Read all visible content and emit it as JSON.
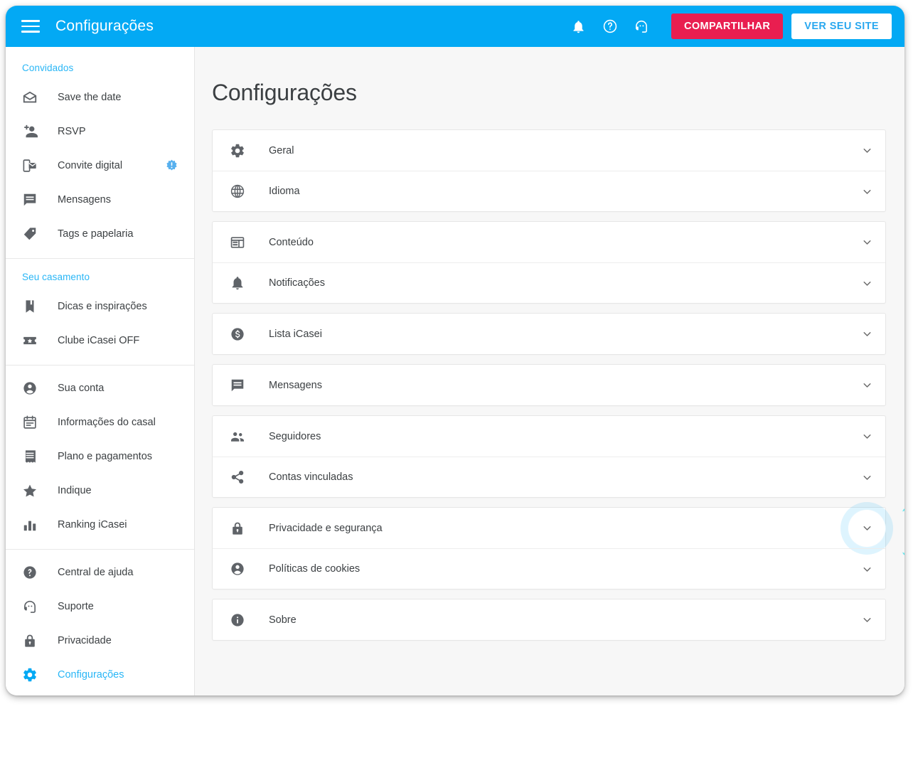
{
  "topbar": {
    "title": "Configurações",
    "menu_icon": "hamburger-menu-icon",
    "icons": [
      {
        "name": "notifications-bell-icon"
      },
      {
        "name": "help-circle-icon"
      },
      {
        "name": "support-headset-icon"
      }
    ],
    "share_label": "COMPARTILHAR",
    "site_label": "VER SEU SITE",
    "accent_color": "#03A9F4",
    "share_color": "#E91E50",
    "site_text_color": "#2aa8ef"
  },
  "sidebar": {
    "sections": [
      {
        "heading": "Convidados",
        "items": [
          {
            "label": "Save the date",
            "icon": "mail-open-icon",
            "badge": null,
            "active": false
          },
          {
            "label": "RSVP",
            "icon": "person-add-icon",
            "badge": null,
            "active": false
          },
          {
            "label": "Convite digital",
            "icon": "mobile-invite-icon",
            "badge": "!",
            "active": false
          },
          {
            "label": "Mensagens",
            "icon": "chat-bubble-icon",
            "badge": null,
            "active": false
          },
          {
            "label": "Tags e papelaria",
            "icon": "tag-icon",
            "badge": null,
            "active": false
          }
        ]
      },
      {
        "heading": "Seu casamento",
        "items": [
          {
            "label": "Dicas e inspirações",
            "icon": "bookmark-book-icon",
            "badge": null,
            "active": false
          },
          {
            "label": "Clube iCasei OFF",
            "icon": "ticket-star-icon",
            "badge": null,
            "active": false
          }
        ]
      },
      {
        "heading": null,
        "items": [
          {
            "label": "Sua conta",
            "icon": "account-circle-icon",
            "badge": null,
            "active": false
          },
          {
            "label": "Informações do casal",
            "icon": "calendar-note-icon",
            "badge": null,
            "active": false
          },
          {
            "label": "Plano e pagamentos",
            "icon": "receipt-icon",
            "badge": null,
            "active": false
          },
          {
            "label": "Indique",
            "icon": "star-icon",
            "badge": null,
            "active": false
          },
          {
            "label": "Ranking iCasei",
            "icon": "bar-chart-icon",
            "badge": null,
            "active": false
          }
        ]
      },
      {
        "heading": null,
        "items": [
          {
            "label": "Central de ajuda",
            "icon": "help-circle-filled-icon",
            "badge": null,
            "active": false
          },
          {
            "label": "Suporte",
            "icon": "support-headset-icon",
            "badge": null,
            "active": false
          },
          {
            "label": "Privacidade",
            "icon": "lock-icon",
            "badge": null,
            "active": false
          },
          {
            "label": "Configurações",
            "icon": "gear-icon",
            "badge": null,
            "active": true
          }
        ]
      }
    ],
    "active_color": "#29b6f6"
  },
  "main": {
    "page_title": "Configurações",
    "groups": [
      {
        "rows": [
          {
            "label": "Geral",
            "icon": "gear-icon",
            "chevron": "chevron-down-icon",
            "focused": false
          },
          {
            "label": "Idioma",
            "icon": "globe-icon",
            "chevron": "chevron-down-icon",
            "focused": false
          }
        ]
      },
      {
        "rows": [
          {
            "label": "Conteúdo",
            "icon": "layout-panel-icon",
            "chevron": "chevron-down-icon",
            "focused": false
          },
          {
            "label": "Notificações",
            "icon": "bell-icon",
            "chevron": "chevron-down-icon",
            "focused": false
          }
        ]
      },
      {
        "rows": [
          {
            "label": "Lista iCasei",
            "icon": "money-dollar-circle-icon",
            "chevron": "chevron-down-icon",
            "focused": false
          }
        ]
      },
      {
        "rows": [
          {
            "label": "Mensagens",
            "icon": "chat-bubble-icon",
            "chevron": "chevron-down-icon",
            "focused": false
          }
        ]
      },
      {
        "rows": [
          {
            "label": "Seguidores",
            "icon": "people-group-icon",
            "chevron": "chevron-down-icon",
            "focused": false
          },
          {
            "label": "Contas vinculadas",
            "icon": "share-nodes-icon",
            "chevron": "chevron-down-icon",
            "focused": false
          }
        ]
      },
      {
        "rows": [
          {
            "label": "Privacidade e segurança",
            "icon": "lock-icon",
            "chevron": "chevron-down-icon",
            "focused": true
          },
          {
            "label": "Políticas de cookies",
            "icon": "account-circle-icon",
            "chevron": "chevron-down-icon",
            "focused": false
          }
        ]
      },
      {
        "rows": [
          {
            "label": "Sobre",
            "icon": "info-circle-icon",
            "chevron": "chevron-down-icon",
            "focused": false
          }
        ]
      }
    ],
    "background_color": "#f7f7f7"
  }
}
